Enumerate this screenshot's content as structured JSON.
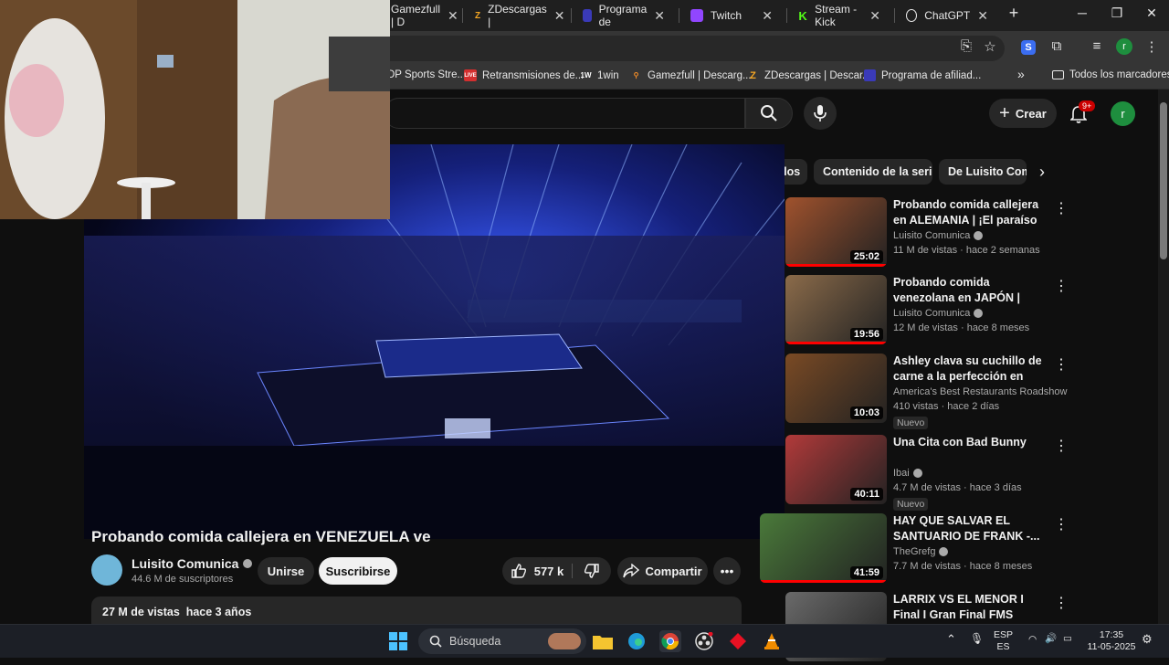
{
  "browser": {
    "tabs": [
      {
        "title": "Gamezfull | D",
        "color": "#f28c28"
      },
      {
        "title": "ZDescargas |",
        "color": "#f5a623",
        "glyph": "Z"
      },
      {
        "title": "Programa de",
        "color": "#3a3ab8"
      },
      {
        "title": "Twitch",
        "color": "#9146ff"
      },
      {
        "title": "Stream - Kick",
        "color": "#53fc18",
        "glyph": "K"
      },
      {
        "title": "ChatGPT",
        "color": "#e8e8e8"
      }
    ],
    "bookmarks": [
      {
        "label": "DP Sports Stre...",
        "color": "#888"
      },
      {
        "label": "Retransmisiones de...",
        "color": "#d32f2f",
        "glyph": "LIVE"
      },
      {
        "label": "1win",
        "color": "#ffffff",
        "glyph": "1W"
      },
      {
        "label": "Gamezfull | Descarg...",
        "color": "#f28c28"
      },
      {
        "label": "ZDescargas | Descar...",
        "color": "#f5a623",
        "glyph": "Z"
      },
      {
        "label": "Programa de afiliad...",
        "color": "#3a3ab8"
      }
    ],
    "bookmarks_overflow": "»",
    "all_bookmarks": "Todos los marcadores",
    "profile_initial": "r"
  },
  "youtube": {
    "create_label": "Crear",
    "notif_badge": "9+",
    "avatar_initial": "r",
    "chips": [
      "dos",
      "Contenido de la serie",
      "De Luisito Comu"
    ],
    "video": {
      "title": "Probando comida callejera en VENEZUELA ve",
      "channel": "Luisito Comunica",
      "subscribers": "44.6 M de suscriptores",
      "join_label": "Unirse",
      "subscribe_label": "Suscribirse",
      "likes": "577 k",
      "share_label": "Compartir",
      "views": "27 M de vistas",
      "age": "hace 3 años"
    },
    "recommendations": [
      {
        "title": "Probando comida callejera en ALEMANIA | ¡El paraíso de la ...",
        "channel": "Luisito Comunica",
        "verified": true,
        "meta": "11 M de vistas · hace 2 semanas",
        "duration": "25:02",
        "progress": 1.0,
        "nuevo": ""
      },
      {
        "title": "Probando comida venezolana en JAPÓN | ¿Arepas con ...",
        "channel": "Luisito Comunica",
        "verified": true,
        "meta": "12 M de vistas · hace 8 meses",
        "duration": "19:56",
        "progress": 1.0,
        "nuevo": ""
      },
      {
        "title": "Ashley clava su cuchillo de carne a la perfección en Bandi...",
        "channel": "America's Best Restaurants Roadshow",
        "verified": false,
        "meta": "410 vistas · hace 2 días",
        "duration": "10:03",
        "progress": 0,
        "nuevo": "Nuevo"
      },
      {
        "title": "Una Cita con Bad Bunny",
        "channel": "Ibai",
        "verified": true,
        "meta": "4.7 M de vistas · hace 3 días",
        "duration": "40:11",
        "progress": 0,
        "nuevo": "Nuevo"
      },
      {
        "title": "HAY QUE SALVAR EL SANTUARIO DE FRANK -...",
        "channel": "TheGrefg",
        "verified": true,
        "meta": "7.7 M de vistas · hace 8 meses",
        "duration": "41:59",
        "progress": 1.0,
        "nuevo": ""
      },
      {
        "title": "LARRIX VS EL MENOR I Final I Gran Final FMS Internacional ...",
        "channel": "",
        "verified": false,
        "meta": "",
        "duration": "",
        "progress": 0,
        "nuevo": ""
      }
    ]
  },
  "taskbar": {
    "search_placeholder": "Búsqueda",
    "lang_top": "ESP",
    "lang_bottom": "ES",
    "time": "17:35",
    "date": "11-05-2025"
  }
}
